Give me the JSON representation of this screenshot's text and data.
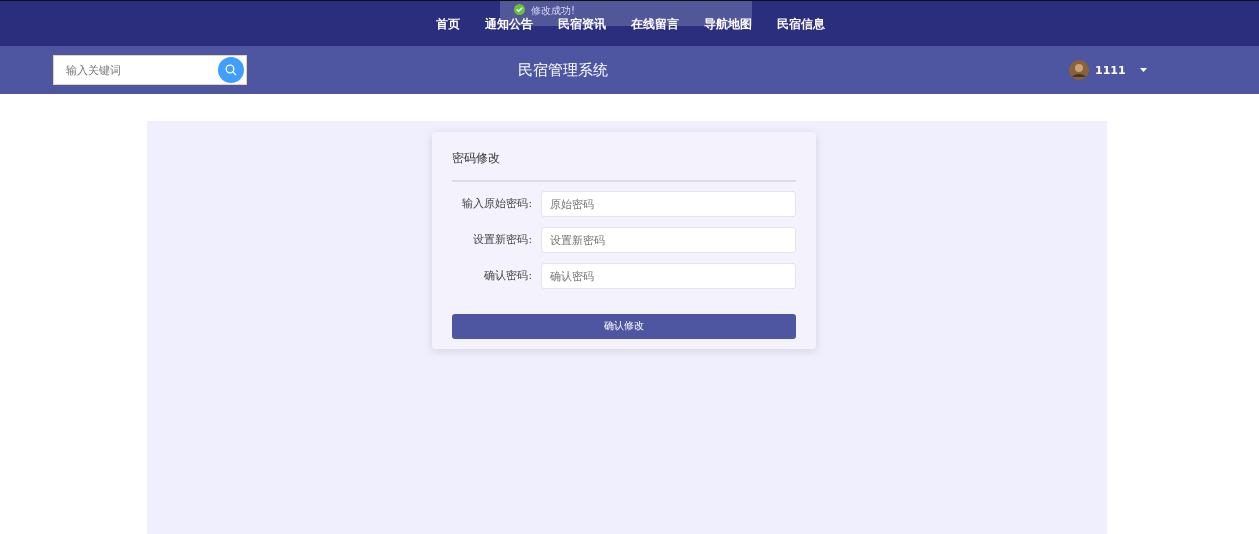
{
  "toast": {
    "text": "修改成功!"
  },
  "nav": [
    {
      "label": "首页"
    },
    {
      "label": "通知公告"
    },
    {
      "label": "民宿资讯"
    },
    {
      "label": "在线留言"
    },
    {
      "label": "导航地图"
    },
    {
      "label": "民宿信息"
    }
  ],
  "header": {
    "search": {
      "placeholder": "输入关键词"
    },
    "title": "民宿管理系统",
    "user": {
      "name": "1111"
    }
  },
  "form": {
    "title": "密码修改",
    "fields": [
      {
        "label": "输入原始密码:",
        "placeholder": "原始密码"
      },
      {
        "label": "设置新密码:",
        "placeholder": "设置新密码"
      },
      {
        "label": "确认密码:",
        "placeholder": "确认密码"
      }
    ],
    "submit": "确认修改"
  }
}
